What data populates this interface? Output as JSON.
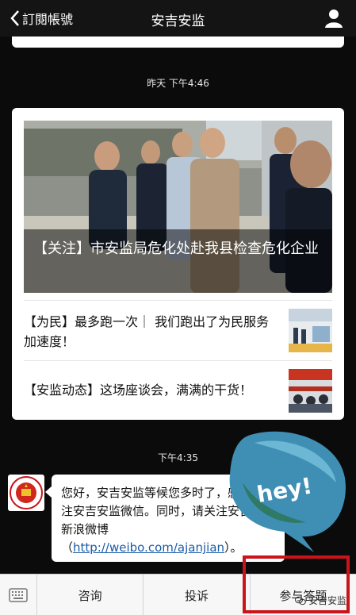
{
  "header": {
    "back_label": "訂閱帳號",
    "title": "安吉安监"
  },
  "timestamps": {
    "first": "昨天 下午4:46",
    "second": "下午4:35"
  },
  "news": {
    "headline": "【关注】市安监局危化处赴我县检查危化企业",
    "items": [
      {
        "title": "【为民】最多跑一次｜ 我们跑出了为民服务加速度！"
      },
      {
        "title": "【安监动态】这场座谈会，满满的干货！"
      }
    ]
  },
  "message": {
    "text": "您好，安吉安监等候您多时了，感谢您关注安吉安监微信。同时，请关注安吉安监新浪微博（",
    "link": "http://weibo.com/ajanjian",
    "suffix": "）。"
  },
  "sticker": {
    "text": "hey!"
  },
  "menu": {
    "items": [
      "咨询",
      "投诉",
      "参与答题"
    ]
  },
  "watermark": "安吉安监",
  "colors": {
    "highlight_box": "#c8141a",
    "link": "#1a5ca8",
    "sticker": "#3f8fb5"
  }
}
